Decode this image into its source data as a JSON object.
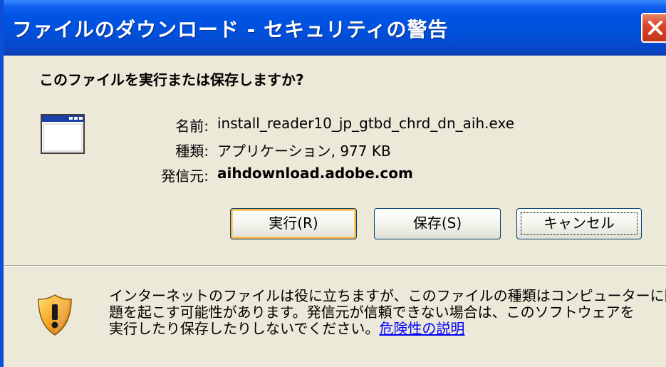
{
  "window": {
    "title": "ファイルのダウンロード - セキュリティの警告"
  },
  "dialog": {
    "question": "このファイルを実行または保存しますか?",
    "file_icon": "application-window-icon",
    "info": {
      "name_label": "名前:",
      "name_value": "install_reader10_jp_gtbd_chrd_dn_aih.exe",
      "type_label": "種類:",
      "type_value": "アプリケーション, 977 KB",
      "from_label": "発信元:",
      "from_value": "aihdownload.adobe.com"
    },
    "buttons": {
      "run": "実行(R)",
      "save": "保存(S)",
      "cancel": "キャンセル"
    }
  },
  "warning": {
    "icon": "security-shield-icon",
    "line1": "インターネットのファイルは役に立ちますが、このファイルの種類はコンピューターに問",
    "line2": "題を起こす可能性があります。発信元が信頼できない場合は、このソフトウェアを",
    "line3": "実行したり保存したりしないでください。",
    "link": "危険性の説明"
  },
  "colors": {
    "titlebar": "#0054e3",
    "dialog_background": "#ece9d8",
    "close_button": "#d9472a",
    "link": "#0000ff",
    "default_button_highlight": "#f6b441"
  }
}
